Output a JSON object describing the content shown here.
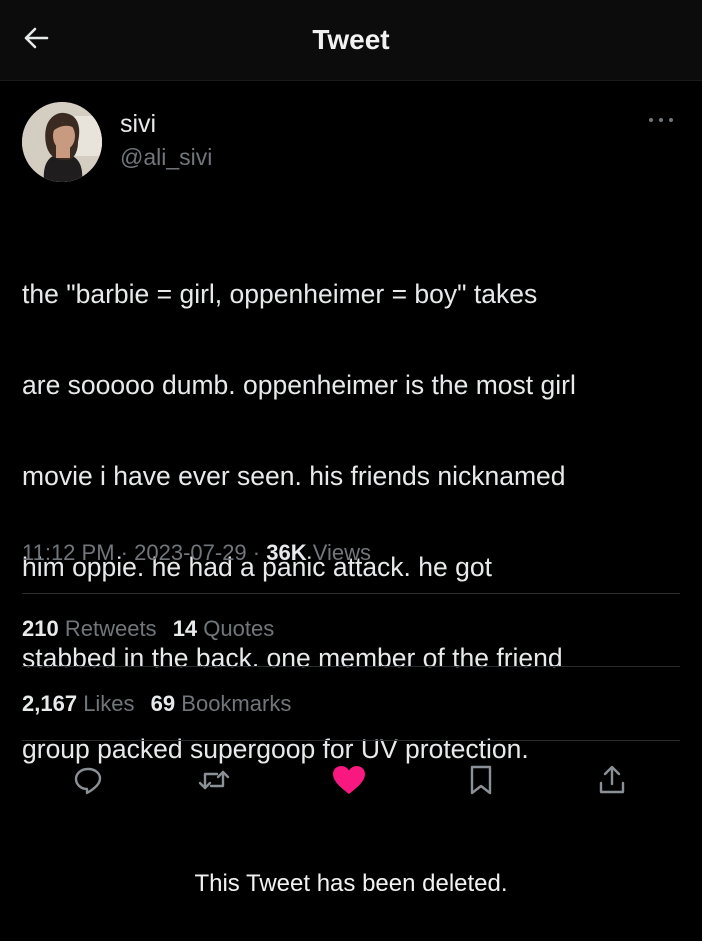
{
  "header": {
    "title": "Tweet",
    "back_icon": "arrow-left-icon"
  },
  "author": {
    "display_name": "sivi",
    "handle": "@ali_sivi",
    "more_icon": "more-horizontal-icon"
  },
  "tweet": {
    "text": "the \"barbie = girl, oppenheimer = boy\" takes are sooooo dumb. oppenheimer is the most girl movie i have ever seen. his friends nicknamed him oppie. he had a panic attack. he got stabbed in the back. one member of the friend group packed supergoop for UV protection.",
    "lines": [
      "the \"barbie = girl, oppenheimer = boy\" takes",
      "are sooooo dumb. oppenheimer is the most girl",
      "movie i have ever seen. his friends nicknamed",
      "him oppie. he had a panic attack. he got",
      "stabbed in the back. one member of the friend",
      "group packed supergoop for UV protection."
    ]
  },
  "meta": {
    "time": "11:12 PM",
    "separator": "·",
    "date": "2023-07-29",
    "views_count": "36K",
    "views_label": "Views"
  },
  "stats": {
    "retweets_count": "210",
    "retweets_label": "Retweets",
    "quotes_count": "14",
    "quotes_label": "Quotes",
    "likes_count": "2,167",
    "likes_label": "Likes",
    "bookmarks_count": "69",
    "bookmarks_label": "Bookmarks"
  },
  "actions": {
    "reply_icon": "reply-icon",
    "retweet_icon": "retweet-icon",
    "like_icon": "heart-icon",
    "bookmark_icon": "bookmark-icon",
    "share_icon": "share-icon"
  },
  "colors": {
    "background": "#000000",
    "text": "#e7e9ea",
    "muted": "#71767b",
    "like_active": "#f91880"
  },
  "footer": {
    "deleted_notice": "This Tweet has been deleted."
  }
}
